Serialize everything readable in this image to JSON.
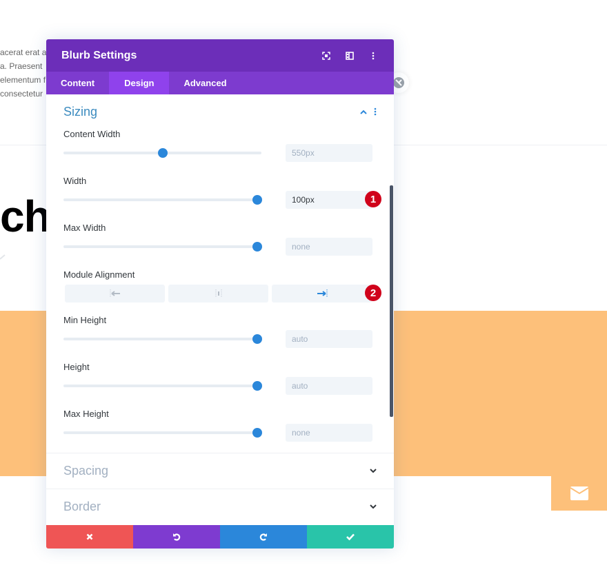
{
  "background": {
    "text_lines": [
      "acerat erat a",
      "a. Praesent",
      "elementum f",
      "consectetur"
    ],
    "heading_fragment": "ch",
    "colors": {
      "orange": "#fdc07a"
    }
  },
  "modal": {
    "title": "Blurb Settings",
    "header_icons": [
      "fullscreen-icon",
      "split-view-icon",
      "more-options-icon"
    ],
    "tabs": [
      {
        "label": "Content",
        "active": false
      },
      {
        "label": "Design",
        "active": true
      },
      {
        "label": "Advanced",
        "active": false
      }
    ],
    "colors": {
      "header": "#6c2eb9",
      "tabs": "#7d3bcf",
      "active_tab": "#8f42ec",
      "accent": "#2b87da"
    },
    "sections": {
      "sizing": {
        "title": "Sizing",
        "expanded": true,
        "fields": [
          {
            "label": "Content Width",
            "value": "550px",
            "slider_fraction": 0.5,
            "active": false
          },
          {
            "label": "Width",
            "value": "100px",
            "slider_fraction": 1.0,
            "active": true,
            "badge": "1"
          },
          {
            "label": "Max Width",
            "value": "none",
            "slider_fraction": 1.0,
            "active": false
          }
        ],
        "alignment": {
          "label": "Module Alignment",
          "options": [
            "left",
            "center",
            "right"
          ],
          "selected": "right",
          "badge": "2"
        },
        "height_fields": [
          {
            "label": "Min Height",
            "value": "auto",
            "slider_fraction": 1.0
          },
          {
            "label": "Height",
            "value": "auto",
            "slider_fraction": 1.0
          },
          {
            "label": "Max Height",
            "value": "none",
            "slider_fraction": 1.0
          }
        ]
      },
      "spacing": {
        "title": "Spacing",
        "expanded": false
      },
      "border": {
        "title": "Border",
        "expanded": false
      }
    },
    "footer": {
      "buttons": [
        {
          "name": "discard",
          "icon": "close-icon",
          "color": "#ef5555"
        },
        {
          "name": "undo",
          "icon": "undo-icon",
          "color": "#7e3bd0"
        },
        {
          "name": "redo",
          "icon": "redo-icon",
          "color": "#2b87da"
        },
        {
          "name": "save",
          "icon": "check-icon",
          "color": "#29c4a9"
        }
      ]
    }
  }
}
